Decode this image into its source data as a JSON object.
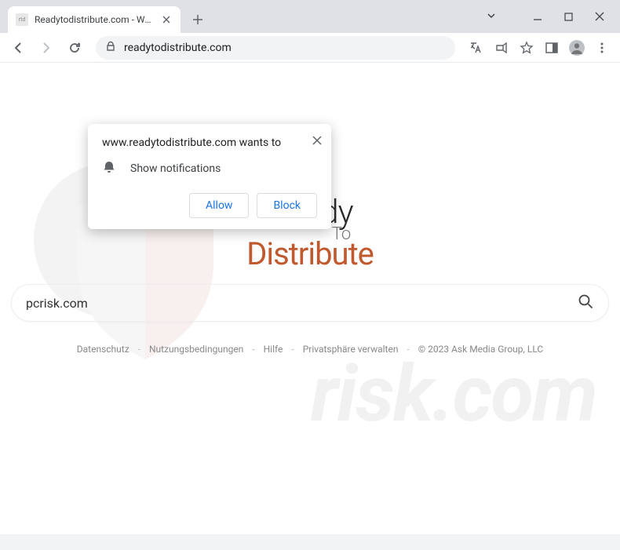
{
  "browser": {
    "tab_title": "Readytodistribute.com - What's Y",
    "url": "readytodistribute.com"
  },
  "notification": {
    "prompt": "www.readytodistribute.com wants to",
    "permission_label": "Show notifications",
    "allow": "Allow",
    "block": "Block"
  },
  "page": {
    "logo_ready": "Ready",
    "logo_to": "To",
    "logo_distribute": "Distribute",
    "search_value": "pcrisk.com"
  },
  "footer": {
    "links": {
      "privacy": "Datenschutz",
      "terms": "Nutzungsbedingungen",
      "help": "Hilfe",
      "manage_privacy": "Privatsphäre verwalten"
    },
    "copyright": "© 2023 Ask Media Group, LLC"
  },
  "watermark": {
    "text": "risk.com"
  }
}
